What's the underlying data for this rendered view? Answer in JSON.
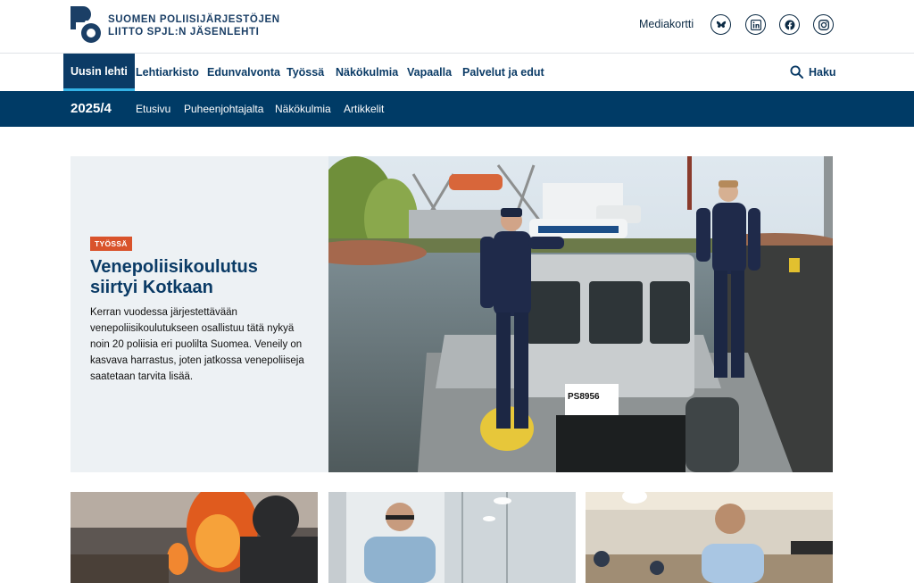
{
  "header": {
    "logo_text_line1": "Suomen Poliisijärjestöjen",
    "logo_text_line2": "Liitto SPJL:n jäsenlehti",
    "mediakortti": "Mediakortti",
    "social": [
      "bluesky-icon",
      "linkedin-icon",
      "facebook-icon",
      "instagram-icon"
    ]
  },
  "nav": {
    "items": [
      "Uusin lehti",
      "Lehtiarkisto",
      "Edunvalvonta",
      "Työssä",
      "Näkökulmia",
      "Vapaalla",
      "Palvelut ja edut"
    ],
    "search_label": "Haku"
  },
  "subnav": {
    "issue": "2025/4",
    "items": [
      "Etusivu",
      "Puheenjohtajalta",
      "Näkökulmia",
      "Artikkelit"
    ]
  },
  "hero": {
    "tag": "TYÖSSÄ",
    "title": "Venepoliisikoulutus siirtyi Kotkaan",
    "lead": "Kerran vuodessa järjestettävään venepoliisikoulutukseen osallistuu tätä nykyä noin 20 poliisia eri puolilta Suomea. Veneily on kasvava harrastus, joten jatkossa venepoliiseja saatetaan tarvita lisää.",
    "boat_label": "PS8956"
  },
  "colors": {
    "primary": "#0b3b66",
    "subnav_bg": "#003b66",
    "accent": "#34b3e6",
    "tag": "#d9532b",
    "hero_panel": "#edf1f4"
  }
}
